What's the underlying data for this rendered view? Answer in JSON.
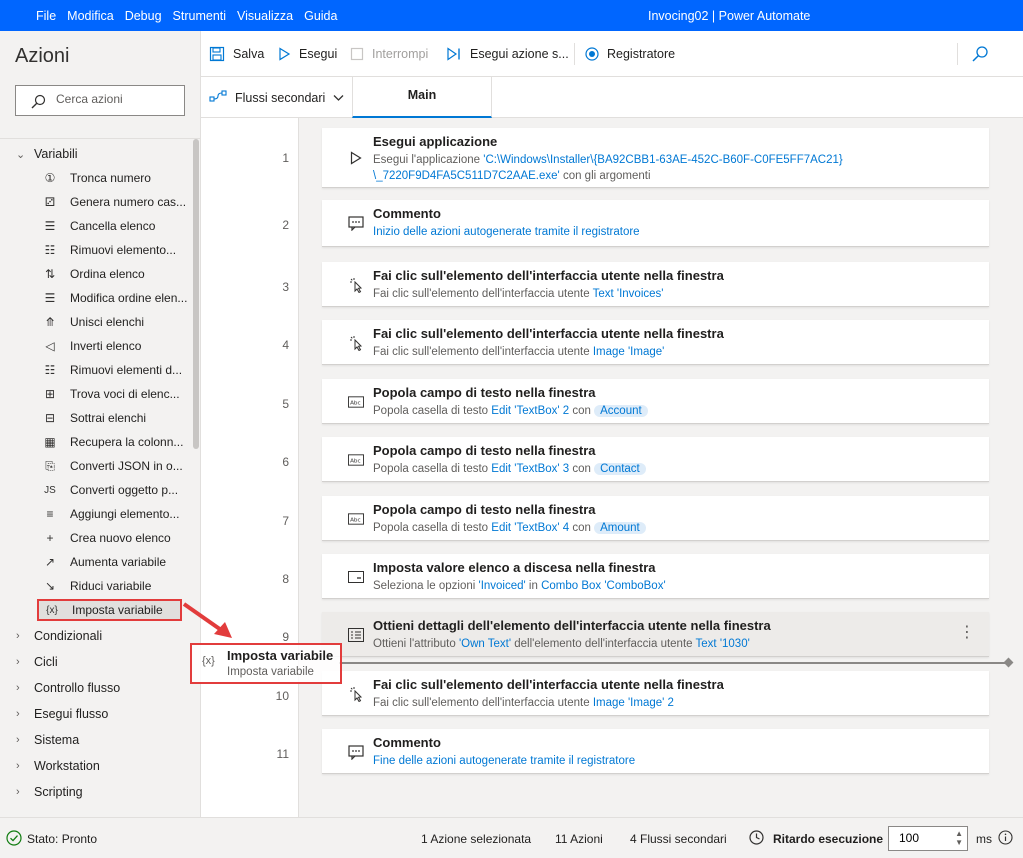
{
  "window": {
    "menu": [
      "File",
      "Modifica",
      "Debug",
      "Strumenti",
      "Visualizza",
      "Guida"
    ],
    "title": "Invocing02 | Power Automate",
    "accent": "#0066ff"
  },
  "actions_panel": {
    "title": "Azioni",
    "search_placeholder": "Cerca azioni",
    "category_open": "Variabili",
    "items": [
      {
        "label": "Tronca numero",
        "icon": "number-circle-icon"
      },
      {
        "label": "Genera numero cas...",
        "icon": "random-number-icon"
      },
      {
        "label": "Cancella elenco",
        "icon": "clear-list-icon"
      },
      {
        "label": "Rimuovi elemento...",
        "icon": "remove-item-icon"
      },
      {
        "label": "Ordina elenco",
        "icon": "sort-list-icon"
      },
      {
        "label": "Modifica ordine elen...",
        "icon": "shuffle-list-icon"
      },
      {
        "label": "Unisci elenchi",
        "icon": "merge-icon"
      },
      {
        "label": "Inverti elenco",
        "icon": "reverse-icon"
      },
      {
        "label": "Rimuovi elementi d...",
        "icon": "remove-duplicates-icon"
      },
      {
        "label": "Trova voci di elenc...",
        "icon": "find-common-icon"
      },
      {
        "label": "Sottrai elenchi",
        "icon": "subtract-lists-icon"
      },
      {
        "label": "Recupera la colonn...",
        "icon": "datatable-column-icon"
      },
      {
        "label": "Converti JSON in o...",
        "icon": "json-convert-icon"
      },
      {
        "label": "Converti oggetto p...",
        "icon": "js-object-icon"
      },
      {
        "label": "Aggiungi elemento...",
        "icon": "add-item-icon"
      },
      {
        "label": "Crea nuovo elenco",
        "icon": "plus-icon"
      },
      {
        "label": "Aumenta variabile",
        "icon": "increase-icon"
      },
      {
        "label": "Riduci variabile",
        "icon": "decrease-icon"
      },
      {
        "label": "Imposta variabile",
        "icon": "set-variable-icon",
        "selected": true
      }
    ],
    "categories": [
      "Condizionali",
      "Cicli",
      "Controllo flusso",
      "Esegui flusso",
      "Sistema",
      "Workstation",
      "Scripting"
    ]
  },
  "toolbar": {
    "save": "Salva",
    "run": "Esegui",
    "stop": "Interrompi",
    "run_next": "Esegui azione s...",
    "recorder": "Registratore"
  },
  "tabs": {
    "subflows": "Flussi secondari",
    "main": "Main"
  },
  "flow": {
    "steps": [
      {
        "num": "1",
        "title": "Esegui applicazione",
        "icon": "play-icon",
        "desc_html": "Esegui l'applicazione <span class=\"v\">'C:\\Windows\\Installer\\{BA92CBB1-63AE-452C-B60F-C0FE5FF7AC21}</span>",
        "desc2_html": "<span class=\"v\">\\_7220F9D4FA5C511D7C2AAE.exe'</span> con gli argomenti"
      },
      {
        "num": "2",
        "title": "Commento",
        "icon": "comment-icon",
        "desc_html": "<span class=\"v\">Inizio delle azioni autogenerate tramite il registratore</span>"
      },
      {
        "num": "3",
        "title": "Fai clic sull'elemento dell'interfaccia utente nella finestra",
        "icon": "click-icon",
        "desc_html": "Fai clic sull'elemento dell'interfaccia utente <span class=\"v\">Text 'Invoices'</span>"
      },
      {
        "num": "4",
        "title": "Fai clic sull'elemento dell'interfaccia utente nella finestra",
        "icon": "click-icon",
        "desc_html": "Fai clic sull'elemento dell'interfaccia utente <span class=\"v\">Image 'Image'</span>"
      },
      {
        "num": "5",
        "title": "Popola campo di testo nella finestra",
        "icon": "textbox-icon",
        "desc_html": "Popola casella di testo <span class=\"v\">Edit 'TextBox' 2</span> con <span class=\"chip\">Account</span>"
      },
      {
        "num": "6",
        "title": "Popola campo di testo nella finestra",
        "icon": "textbox-icon",
        "desc_html": "Popola casella di testo <span class=\"v\">Edit 'TextBox' 3</span> con <span class=\"chip\">Contact</span>"
      },
      {
        "num": "7",
        "title": "Popola campo di testo nella finestra",
        "icon": "textbox-icon",
        "desc_html": "Popola casella di testo <span class=\"v\">Edit 'TextBox' 4</span> con <span class=\"chip\">Amount</span>"
      },
      {
        "num": "8",
        "title": "Imposta valore elenco a discesa nella finestra",
        "icon": "dropdown-icon",
        "desc_html": "Seleziona le opzioni <span class=\"v\">'Invoiced'</span> in <span class=\"v\">Combo Box 'ComboBox'</span>"
      },
      {
        "num": "9",
        "title": "Ottieni dettagli dell'elemento dell'interfaccia utente nella finestra",
        "icon": "details-icon",
        "desc_html": "Ottieni l'attributo <span class=\"v\">'Own Text'</span> dell'elemento dell'interfaccia utente <span class=\"v\">Text '1030'</span>"
      },
      {
        "num": "10",
        "title": "Fai clic sull'elemento dell'interfaccia utente nella finestra",
        "icon": "click-icon",
        "desc_html": "Fai clic sull'elemento dell'interfaccia utente <span class=\"v\">Image 'Image' 2</span>"
      },
      {
        "num": "11",
        "title": "Commento",
        "icon": "comment-icon",
        "desc_html": "<span class=\"v\">Fine delle azioni autogenerate tramite il registratore</span>"
      }
    ],
    "drag_ghost": {
      "title": "Imposta variabile",
      "subtitle": "Imposta variabile",
      "icon_text": "{x}"
    }
  },
  "status": {
    "state": "Stato: Pronto",
    "selected": "1 Azione selezionata",
    "actions": "11 Azioni",
    "subflows": "4 Flussi secondari",
    "delay_label": "Ritardo esecuzione",
    "delay_value": "100",
    "unit": "ms"
  }
}
